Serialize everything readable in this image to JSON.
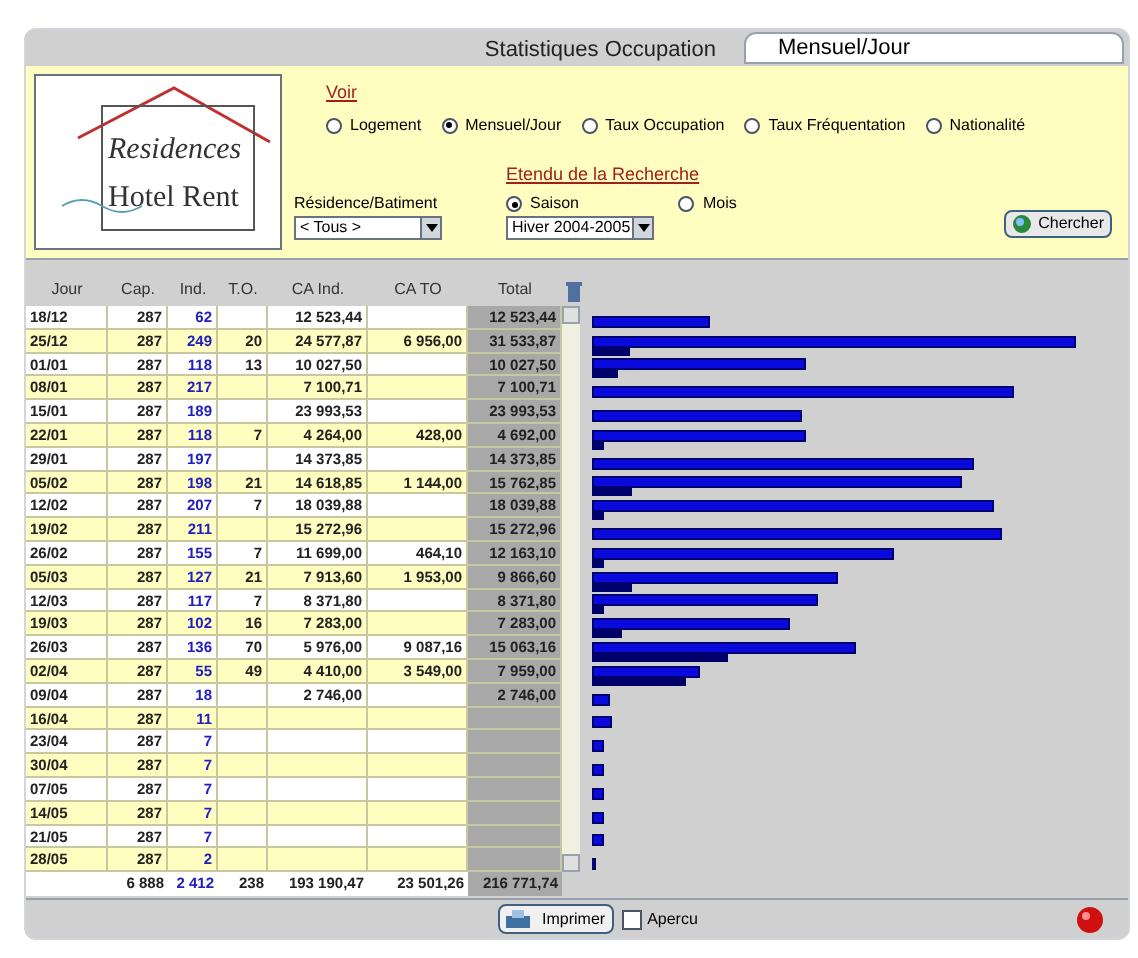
{
  "window": {
    "title": "Statistiques Occupation",
    "tab": "Mensuel/Jour"
  },
  "logo": [
    "Residences",
    "Hotel Rent"
  ],
  "voir": {
    "label": "Voir",
    "options": [
      {
        "label": "Logement",
        "selected": false
      },
      {
        "label": "Mensuel/Jour",
        "selected": true
      },
      {
        "label": "Taux Occupation",
        "selected": false
      },
      {
        "label": "Taux Fréquentation",
        "selected": false
      },
      {
        "label": "Nationalité",
        "selected": false
      }
    ]
  },
  "residence": {
    "label": "Résidence/Batiment",
    "value": "< Tous >"
  },
  "etendu": {
    "label": "Etendu de la Recherche",
    "options": [
      {
        "label": "Saison",
        "selected": true
      },
      {
        "label": "Mois",
        "selected": false
      }
    ],
    "value": "Hiver 2004-2005"
  },
  "search_button": "Chercher",
  "table": {
    "columns": [
      "Jour",
      "Cap.",
      "Ind.",
      "T.O.",
      "CA Ind.",
      "CA TO",
      "Total"
    ],
    "rows": [
      [
        "18/12",
        "287",
        "62",
        "",
        "12 523,44",
        "",
        "12 523,44"
      ],
      [
        "25/12",
        "287",
        "249",
        "20",
        "24 577,87",
        "6 956,00",
        "31 533,87"
      ],
      [
        "01/01",
        "287",
        "118",
        "13",
        "10 027,50",
        "",
        "10 027,50"
      ],
      [
        "08/01",
        "287",
        "217",
        "",
        "7 100,71",
        "",
        "7 100,71"
      ],
      [
        "15/01",
        "287",
        "189",
        "",
        "23 993,53",
        "",
        "23 993,53"
      ],
      [
        "22/01",
        "287",
        "118",
        "7",
        "4 264,00",
        "428,00",
        "4 692,00"
      ],
      [
        "29/01",
        "287",
        "197",
        "",
        "14 373,85",
        "",
        "14 373,85"
      ],
      [
        "05/02",
        "287",
        "198",
        "21",
        "14 618,85",
        "1 144,00",
        "15 762,85"
      ],
      [
        "12/02",
        "287",
        "207",
        "7",
        "18 039,88",
        "",
        "18 039,88"
      ],
      [
        "19/02",
        "287",
        "211",
        "",
        "15 272,96",
        "",
        "15 272,96"
      ],
      [
        "26/02",
        "287",
        "155",
        "7",
        "11 699,00",
        "464,10",
        "12 163,10"
      ],
      [
        "05/03",
        "287",
        "127",
        "21",
        "7 913,60",
        "1 953,00",
        "9 866,60"
      ],
      [
        "12/03",
        "287",
        "117",
        "7",
        "8 371,80",
        "",
        "8 371,80"
      ],
      [
        "19/03",
        "287",
        "102",
        "16",
        "7 283,00",
        "",
        "7 283,00"
      ],
      [
        "26/03",
        "287",
        "136",
        "70",
        "5 976,00",
        "9 087,16",
        "15 063,16"
      ],
      [
        "02/04",
        "287",
        "55",
        "49",
        "4 410,00",
        "3 549,00",
        "7 959,00"
      ],
      [
        "09/04",
        "287",
        "18",
        "",
        "2 746,00",
        "",
        "2 746,00"
      ],
      [
        "16/04",
        "287",
        "11",
        "",
        "",
        "",
        ""
      ],
      [
        "23/04",
        "287",
        "7",
        "",
        "",
        "",
        ""
      ],
      [
        "30/04",
        "287",
        "7",
        "",
        "",
        "",
        ""
      ],
      [
        "07/05",
        "287",
        "7",
        "",
        "",
        "",
        ""
      ],
      [
        "14/05",
        "287",
        "7",
        "",
        "",
        "",
        ""
      ],
      [
        "21/05",
        "287",
        "7",
        "",
        "",
        "",
        ""
      ],
      [
        "28/05",
        "287",
        "2",
        "",
        "",
        "",
        ""
      ]
    ],
    "totals": [
      "6 888",
      "2 412",
      "238",
      "193 190,47",
      "23 501,26",
      "216 771,74"
    ]
  },
  "footer": {
    "print_button": "Imprimer",
    "preview": {
      "label": "Apercu",
      "checked": false
    }
  }
}
